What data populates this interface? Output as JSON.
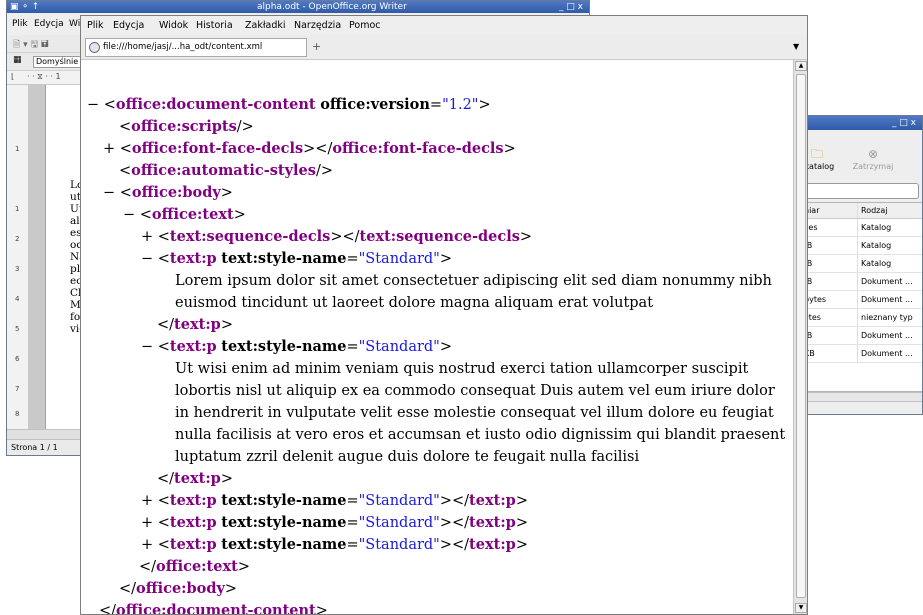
{
  "writer": {
    "title": "alpha.odt - OpenOffice.org Writer",
    "controls": "_ □ x",
    "menu": [
      "Plik",
      "Edycja",
      "Wid"
    ],
    "style_box": "Domyślnie",
    "paragraph_lines": [
      "Lorem·",
      "ut·laore",
      "Ut·wisi",
      "aliquip",
      "esse·m",
      "odio·di",
      "Nam·li",
      "placera",
      "eorum·",
      "Clarita",
      "Mirum",
      "formas",
      "videntu"
    ],
    "status": "Strona 1 / 1"
  },
  "filemgr": {
    "controls": "_ □ x",
    "toolbar": [
      {
        "icon": "folder-icon",
        "label": "j katalog"
      },
      {
        "icon": "stop-icon",
        "label": "Zatrzymaj"
      }
    ],
    "columns": [
      "niar",
      "Rodzaj"
    ],
    "rows": [
      [
        "ces",
        "Katalog"
      ],
      [
        ":B",
        "Katalog"
      ],
      [
        ":B",
        "Katalog"
      ],
      [
        ":B",
        "Dokument ..."
      ],
      [
        "bytes",
        "Dokument ..."
      ],
      [
        "ytes",
        "nieznany typ"
      ],
      [
        ":B",
        "Dokument ..."
      ],
      [
        "KB",
        "Dokument ..."
      ]
    ]
  },
  "browser": {
    "menu": [
      "Plik",
      "Edycja",
      "Widok",
      "Historia",
      "Zakładki",
      "Narzędzia",
      "Pomoc"
    ],
    "tab_label": "file:///home/jasj/...ha_odt/content.xml",
    "new_tab": "+",
    "xml": {
      "lines": [
        {
          "toggle": "−",
          "open": "office:document-content",
          "attr": "office:version",
          "val": "\"1.2\"",
          "close": ""
        },
        {
          "toggle": "",
          "selfclose": "office:scripts"
        },
        {
          "toggle": "+",
          "open_close": "office:font-face-decls"
        },
        {
          "toggle": "",
          "selfclose": "office:automatic-styles"
        },
        {
          "toggle": "−",
          "open": "office:body"
        },
        {
          "toggle": "−",
          "open": "office:text"
        },
        {
          "toggle": "+",
          "open_close": "text:sequence-decls"
        },
        {
          "toggle": "−",
          "open": "text:p",
          "attr": "text:style-name",
          "val": "\"Standard\""
        },
        {
          "text": "Lorem ipsum dolor sit amet consectetuer adipiscing elit sed diam nonummy nibh"
        },
        {
          "text": "euismod tincidunt ut laoreet dolore magna aliquam erat volutpat"
        },
        {
          "close": "text:p"
        },
        {
          "toggle": "−",
          "open": "text:p",
          "attr": "text:style-name",
          "val": "\"Standard\""
        },
        {
          "text": "Ut wisi enim ad minim veniam quis nostrud exerci tation ullamcorper suscipit"
        },
        {
          "text": "lobortis nisl ut aliquip ex ea commodo consequat Duis autem vel eum iriure dolor"
        },
        {
          "text": "in hendrerit in vulputate velit esse molestie consequat vel illum dolore eu feugiat"
        },
        {
          "text": "nulla facilisis at vero eros et accumsan et iusto odio dignissim qui blandit praesent"
        },
        {
          "text": "luptatum zzril delenit augue duis dolore te feugait nulla facilisi"
        },
        {
          "close": "text:p"
        },
        {
          "toggle": "+",
          "open_close_attr": "text:p",
          "attr": "text:style-name",
          "val": "\"Standard\""
        },
        {
          "toggle": "+",
          "open_close_attr": "text:p",
          "attr": "text:style-name",
          "val": "\"Standard\""
        },
        {
          "toggle": "+",
          "open_close_attr": "text:p",
          "attr": "text:style-name",
          "val": "\"Standard\""
        },
        {
          "close": "office:text"
        },
        {
          "close": "office:body"
        },
        {
          "close": "office:document-content"
        }
      ]
    }
  }
}
